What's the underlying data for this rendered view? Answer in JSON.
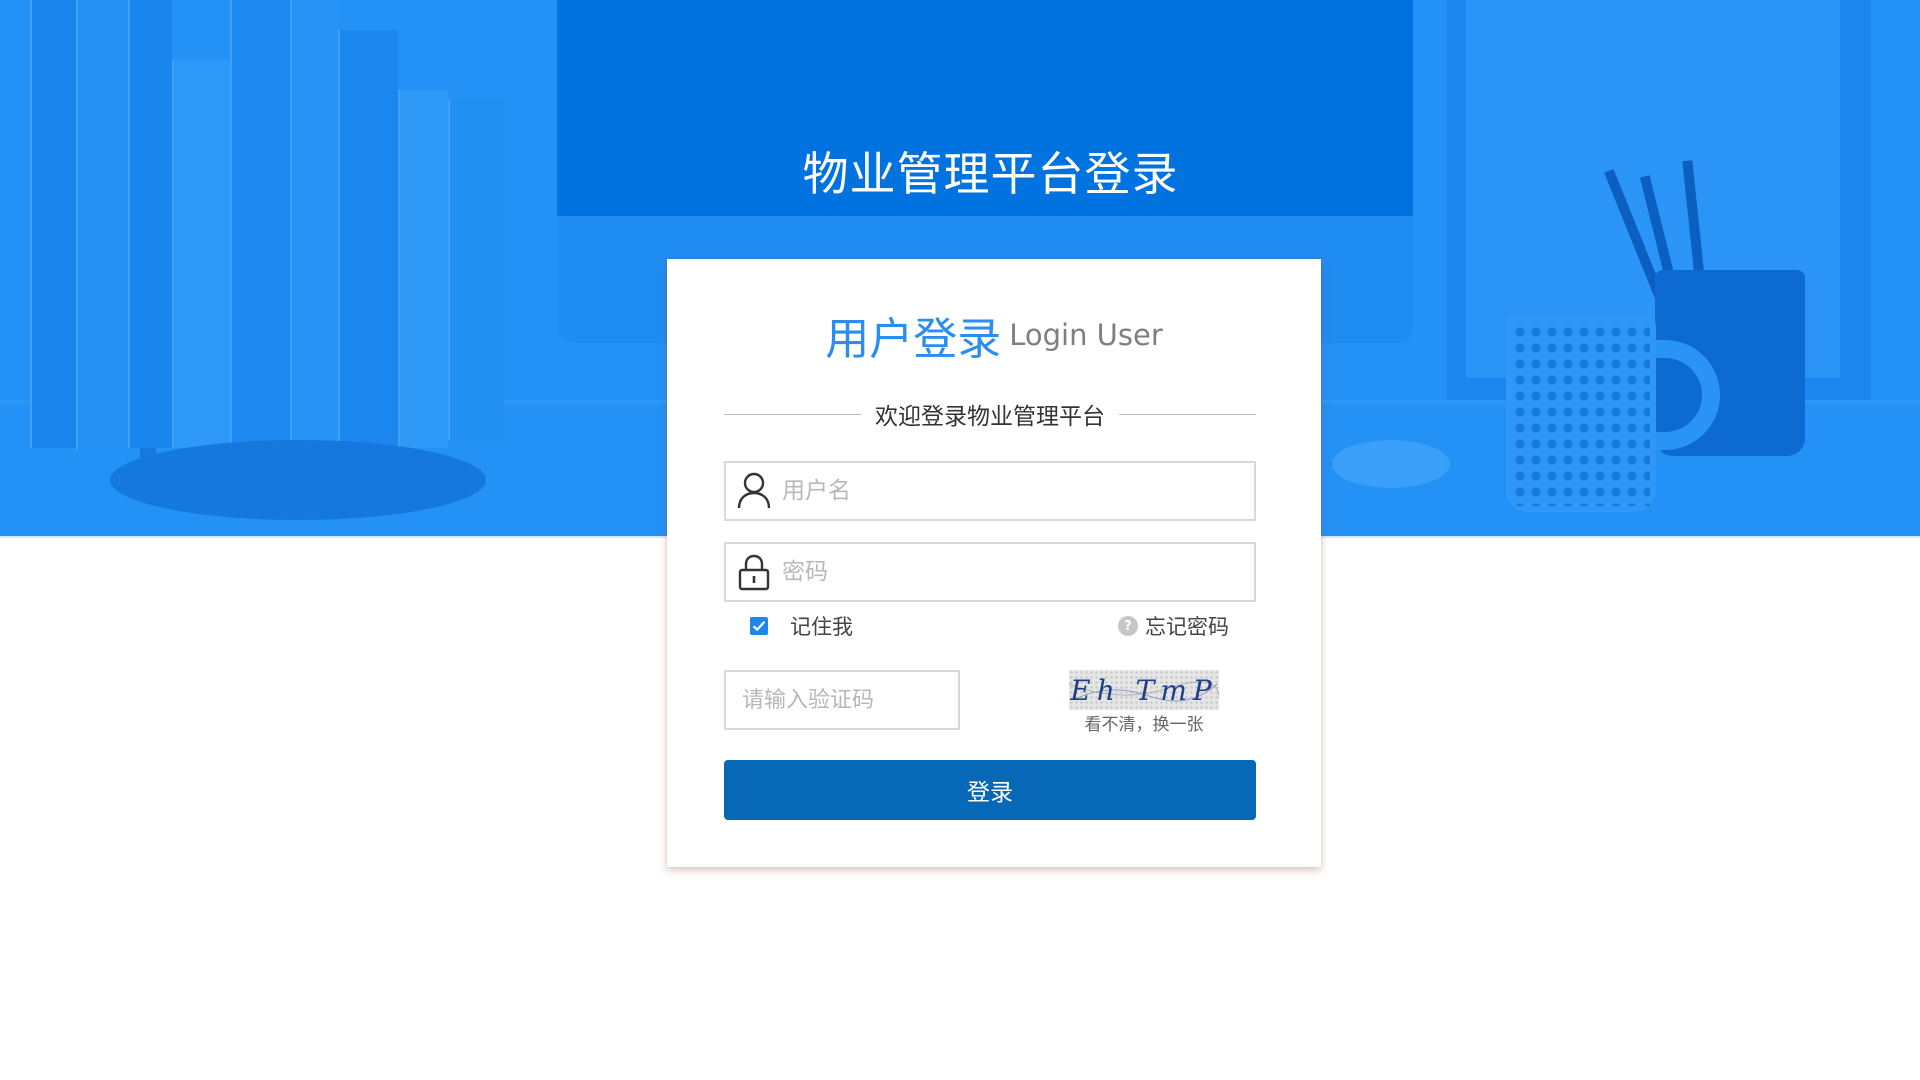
{
  "page": {
    "title": "物业管理平台登录"
  },
  "card": {
    "heading_cn": "用户登录",
    "heading_en": "Login User",
    "welcome": "欢迎登录物业管理平台"
  },
  "form": {
    "username_placeholder": "用户名",
    "username_value": "",
    "password_placeholder": "密码",
    "password_value": "",
    "remember_label": "记住我",
    "remember_checked": true,
    "forgot_label": "忘记密码",
    "captcha_placeholder": "请输入验证码",
    "captcha_value": "",
    "captcha_image_text": "Eh TmP",
    "captcha_refresh_label": "看不清，换一张",
    "submit_label": "登录"
  },
  "icons": {
    "username": "user-icon",
    "password": "lock-icon",
    "remember": "checkbox-checked-icon",
    "forgot": "help-circle-icon"
  },
  "colors": {
    "hero_bg": "#2391f5",
    "heading_accent": "#2a8df0",
    "button_bg": "#0868b8",
    "checkbox": "#1f86ea"
  }
}
